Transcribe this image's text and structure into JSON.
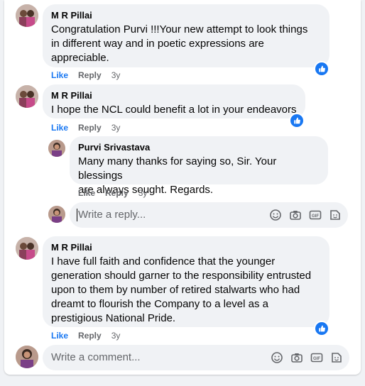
{
  "comments": [
    {
      "author": "M R Pillai",
      "text_lines": [
        "Congratulation Purvi !!!Your new attempt to look things",
        "in different way and in poetic expressions are",
        "appreciable."
      ],
      "actions": {
        "like": "Like",
        "reply": "Reply",
        "time": "3y"
      },
      "reaction_icon": "like-icon"
    },
    {
      "author": "M R Pillai",
      "text_lines": [
        "I hope the NCL could benefit a lot in your endeavors"
      ],
      "actions": {
        "like": "Like",
        "reply": "Reply",
        "time": "3y"
      },
      "reaction_icon": "like-icon",
      "reply": {
        "author": "Purvi Srivastava",
        "text_lines": [
          "Many many thanks for saying so, Sir. Your blessings",
          "are always sought. Regards."
        ],
        "actions": {
          "like": "Like",
          "reply": "Reply",
          "time": "3y"
        }
      },
      "reply_input": {
        "placeholder": "Write a reply..."
      }
    },
    {
      "author": "M R Pillai",
      "text_lines": [
        "I have full faith and confidence that the younger",
        "generation should garner to the responsibility entrusted",
        "upon to them by number of retired stalwarts who had",
        "dreamt to flourish the Company to a level as a",
        "prestigious National Pride."
      ],
      "actions": {
        "like": "Like",
        "reply": "Reply",
        "time": "3y"
      },
      "reaction_icon": "like-icon"
    }
  ],
  "comment_input": {
    "placeholder": "Write a comment..."
  },
  "input_tools": [
    "emoji-icon",
    "camera-icon",
    "gif-icon",
    "sticker-icon"
  ],
  "colors": {
    "accent": "#1877f2",
    "bubble": "#f0f2f5",
    "muted": "#65676b"
  }
}
